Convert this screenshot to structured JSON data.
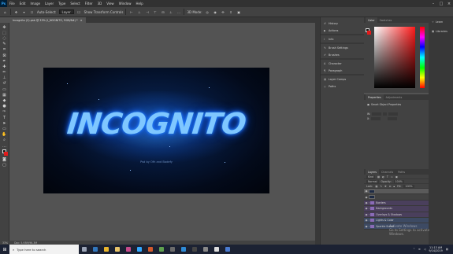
{
  "app": {
    "logo": "Ps"
  },
  "menubar": {
    "items": [
      "File",
      "Edit",
      "Image",
      "Layer",
      "Type",
      "Select",
      "Filter",
      "3D",
      "View",
      "Window",
      "Help"
    ]
  },
  "optbar": {
    "auto_select_label": "Auto-Select:",
    "auto_select_value": "Layer",
    "transform_label": "Show Transform Controls",
    "mode_label": "3D Mode:"
  },
  "document": {
    "tab_label": "Incognito (2).psb @ 33% (I_NOGNITO, RGB/8#) *"
  },
  "artwork": {
    "logo_text": "INCOGNITO",
    "credit_text": "Psd by Ofh and Bodefy"
  },
  "statusbar": {
    "zoom": "33%",
    "doc_info": "Doc: 5.93M/96.3M"
  },
  "dock": {
    "items": [
      {
        "icon": "history-icon",
        "glyph": "↺",
        "label": "History"
      },
      {
        "icon": "actions-icon",
        "glyph": "▶",
        "label": "Actions"
      },
      {
        "icon": "info-icon",
        "glyph": "i",
        "label": "Info"
      },
      {
        "icon": "brush-settings-icon",
        "glyph": "✎",
        "label": "Brush Settings"
      },
      {
        "icon": "brushes-icon",
        "glyph": "✐",
        "label": "Brushes"
      },
      {
        "icon": "character-icon",
        "glyph": "A",
        "label": "Character"
      },
      {
        "icon": "paragraph-icon",
        "glyph": "¶",
        "label": "Paragraph"
      },
      {
        "icon": "layer-comps-icon",
        "glyph": "▤",
        "label": "Layer Comps"
      },
      {
        "icon": "paths-icon",
        "glyph": "◇",
        "label": "Paths"
      }
    ]
  },
  "color_panel": {
    "tabs": [
      "Color",
      "Swatches"
    ],
    "fg": "#1a1a1a",
    "bg": "#e31b1b"
  },
  "properties_panel": {
    "tabs": [
      "Properties",
      "Adjustments"
    ],
    "title": "Smart Object Properties",
    "rows": [
      {
        "label": "W:",
        "value": ""
      },
      {
        "label": "X:",
        "value": ""
      },
      {
        "label": "",
        "value": ""
      }
    ]
  },
  "layers_panel": {
    "tabs": [
      "Layers",
      "Channels",
      "Paths"
    ],
    "kind_label": "Kind",
    "mode": "Normal",
    "opacity_label": "Opacity:",
    "opacity_value": "100%",
    "lock_label": "Lock:",
    "fill_label": "Fill:",
    "fill_value": "100%",
    "layers": [
      {
        "name": "",
        "type": "smart",
        "style": "sel",
        "visible": true
      },
      {
        "name": "",
        "type": "smart",
        "style": "",
        "visible": true
      },
      {
        "name": "Borders",
        "type": "folder",
        "style": "purple",
        "visible": true
      },
      {
        "name": "Backgrounds",
        "type": "folder",
        "style": "purple",
        "visible": true
      },
      {
        "name": "Overlays & Shadows",
        "type": "folder",
        "style": "purple",
        "visible": true
      },
      {
        "name": "Lights & Color",
        "type": "folder",
        "style": "blue",
        "visible": true
      },
      {
        "name": "Sparkle Scene",
        "type": "folder",
        "style": "blue",
        "visible": true
      }
    ]
  },
  "right_strip": {
    "items": [
      {
        "icon": "learn-icon",
        "glyph": "✧",
        "label": "Learn"
      },
      {
        "icon": "libraries-icon",
        "glyph": "▣",
        "label": "Libraries"
      }
    ]
  },
  "watermark": {
    "line1": "Activate Windows",
    "line2": "Go to Settings to activate Windows."
  },
  "taskbar": {
    "search_placeholder": "Type here to search",
    "apps": [
      {
        "name": "task-view",
        "color": "#9aa3b5"
      },
      {
        "name": "edge",
        "color": "#3277bc"
      },
      {
        "name": "chrome",
        "color": "#e9b52c"
      },
      {
        "name": "file-explorer",
        "color": "#e9c46a"
      },
      {
        "name": "photos",
        "color": "#c74a8a"
      },
      {
        "name": "photoshop",
        "color": "#31a8ff"
      },
      {
        "name": "app-7",
        "color": "#d25a2c"
      },
      {
        "name": "app-8",
        "color": "#5fa04e"
      },
      {
        "name": "app-9",
        "color": "#6b6b6b"
      },
      {
        "name": "app-10",
        "color": "#2e8bd6"
      },
      {
        "name": "app-11",
        "color": "#444"
      },
      {
        "name": "app-12",
        "color": "#888"
      },
      {
        "name": "app-13",
        "color": "#ddd"
      },
      {
        "name": "app-14",
        "color": "#4a7bd0"
      }
    ],
    "time": "11:13 AM",
    "date": "9/14/2019"
  }
}
